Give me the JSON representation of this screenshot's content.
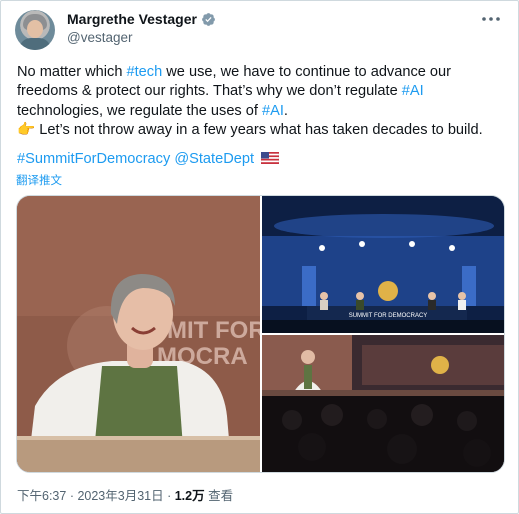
{
  "author": {
    "display_name": "Margrethe Vestager",
    "handle": "@vestager",
    "verified": true
  },
  "more_icon": "more-horizontal-icon",
  "tweet": {
    "segments_line1": [
      {
        "text": "No matter which ",
        "link": false
      },
      {
        "text": "#tech",
        "link": true
      },
      {
        "text": " we use, we have to continue to advance our",
        "link": false
      }
    ],
    "line2": "freedoms & protect our rights. That’s why we don’t regulate ",
    "line2_link": "#AI",
    "line3": "technologies, we regulate the uses of ",
    "line3_link": "#AI",
    "line3_end": ".",
    "line4_emoji": "👉",
    "line4": " Let’s not throw away in a few years what has taken decades to build.",
    "hashtag": "#SummitForDemocracy",
    "mention": "@StateDept"
  },
  "translate_label": "翻译推文",
  "media": {
    "left_sign_line1": "MIT FOR",
    "left_sign_line2": "MOCRA",
    "stage_banner": "SUMMIT FOR DEMOCRACY"
  },
  "footer": {
    "time": "下午6:37",
    "sep1": " · ",
    "date": "2023年3月31日",
    "sep2": " · ",
    "views_count": "1.2万",
    "views_label": " 查看"
  },
  "colors": {
    "link": "#1d9bf0",
    "secondary_text": "#536471",
    "primary_text": "#0f1419",
    "border": "#cfd9de"
  }
}
